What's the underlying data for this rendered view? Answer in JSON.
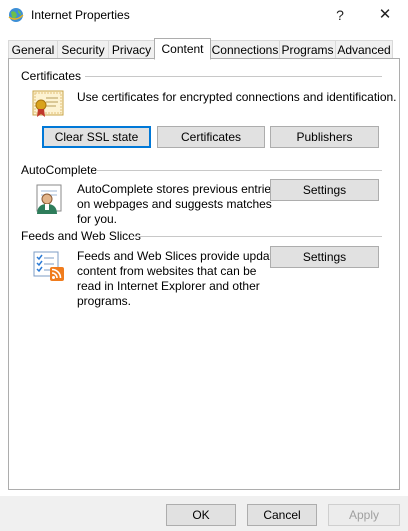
{
  "window": {
    "title": "Internet Properties",
    "help_glyph": "?",
    "close_glyph": "✕"
  },
  "tabs": [
    {
      "label": "General"
    },
    {
      "label": "Security"
    },
    {
      "label": "Privacy"
    },
    {
      "label": "Content",
      "active": true
    },
    {
      "label": "Connections"
    },
    {
      "label": "Programs"
    },
    {
      "label": "Advanced"
    }
  ],
  "certificates": {
    "title": "Certificates",
    "description": "Use certificates for encrypted connections and identification.",
    "buttons": {
      "clear_ssl": "Clear SSL state",
      "certificates": "Certificates",
      "publishers": "Publishers"
    }
  },
  "autocomplete": {
    "title": "AutoComplete",
    "description_lines": [
      "AutoComplete stores previous entries",
      "on webpages and suggests matches",
      "for you."
    ],
    "settings_label": "Settings"
  },
  "feeds": {
    "title": "Feeds and Web Slices",
    "description_lines": [
      "Feeds and Web Slices provide updated",
      "content from websites that can be",
      "read in Internet Explorer and other",
      "programs."
    ],
    "settings_label": "Settings"
  },
  "footer": {
    "ok": "OK",
    "cancel": "Cancel",
    "apply": "Apply"
  }
}
